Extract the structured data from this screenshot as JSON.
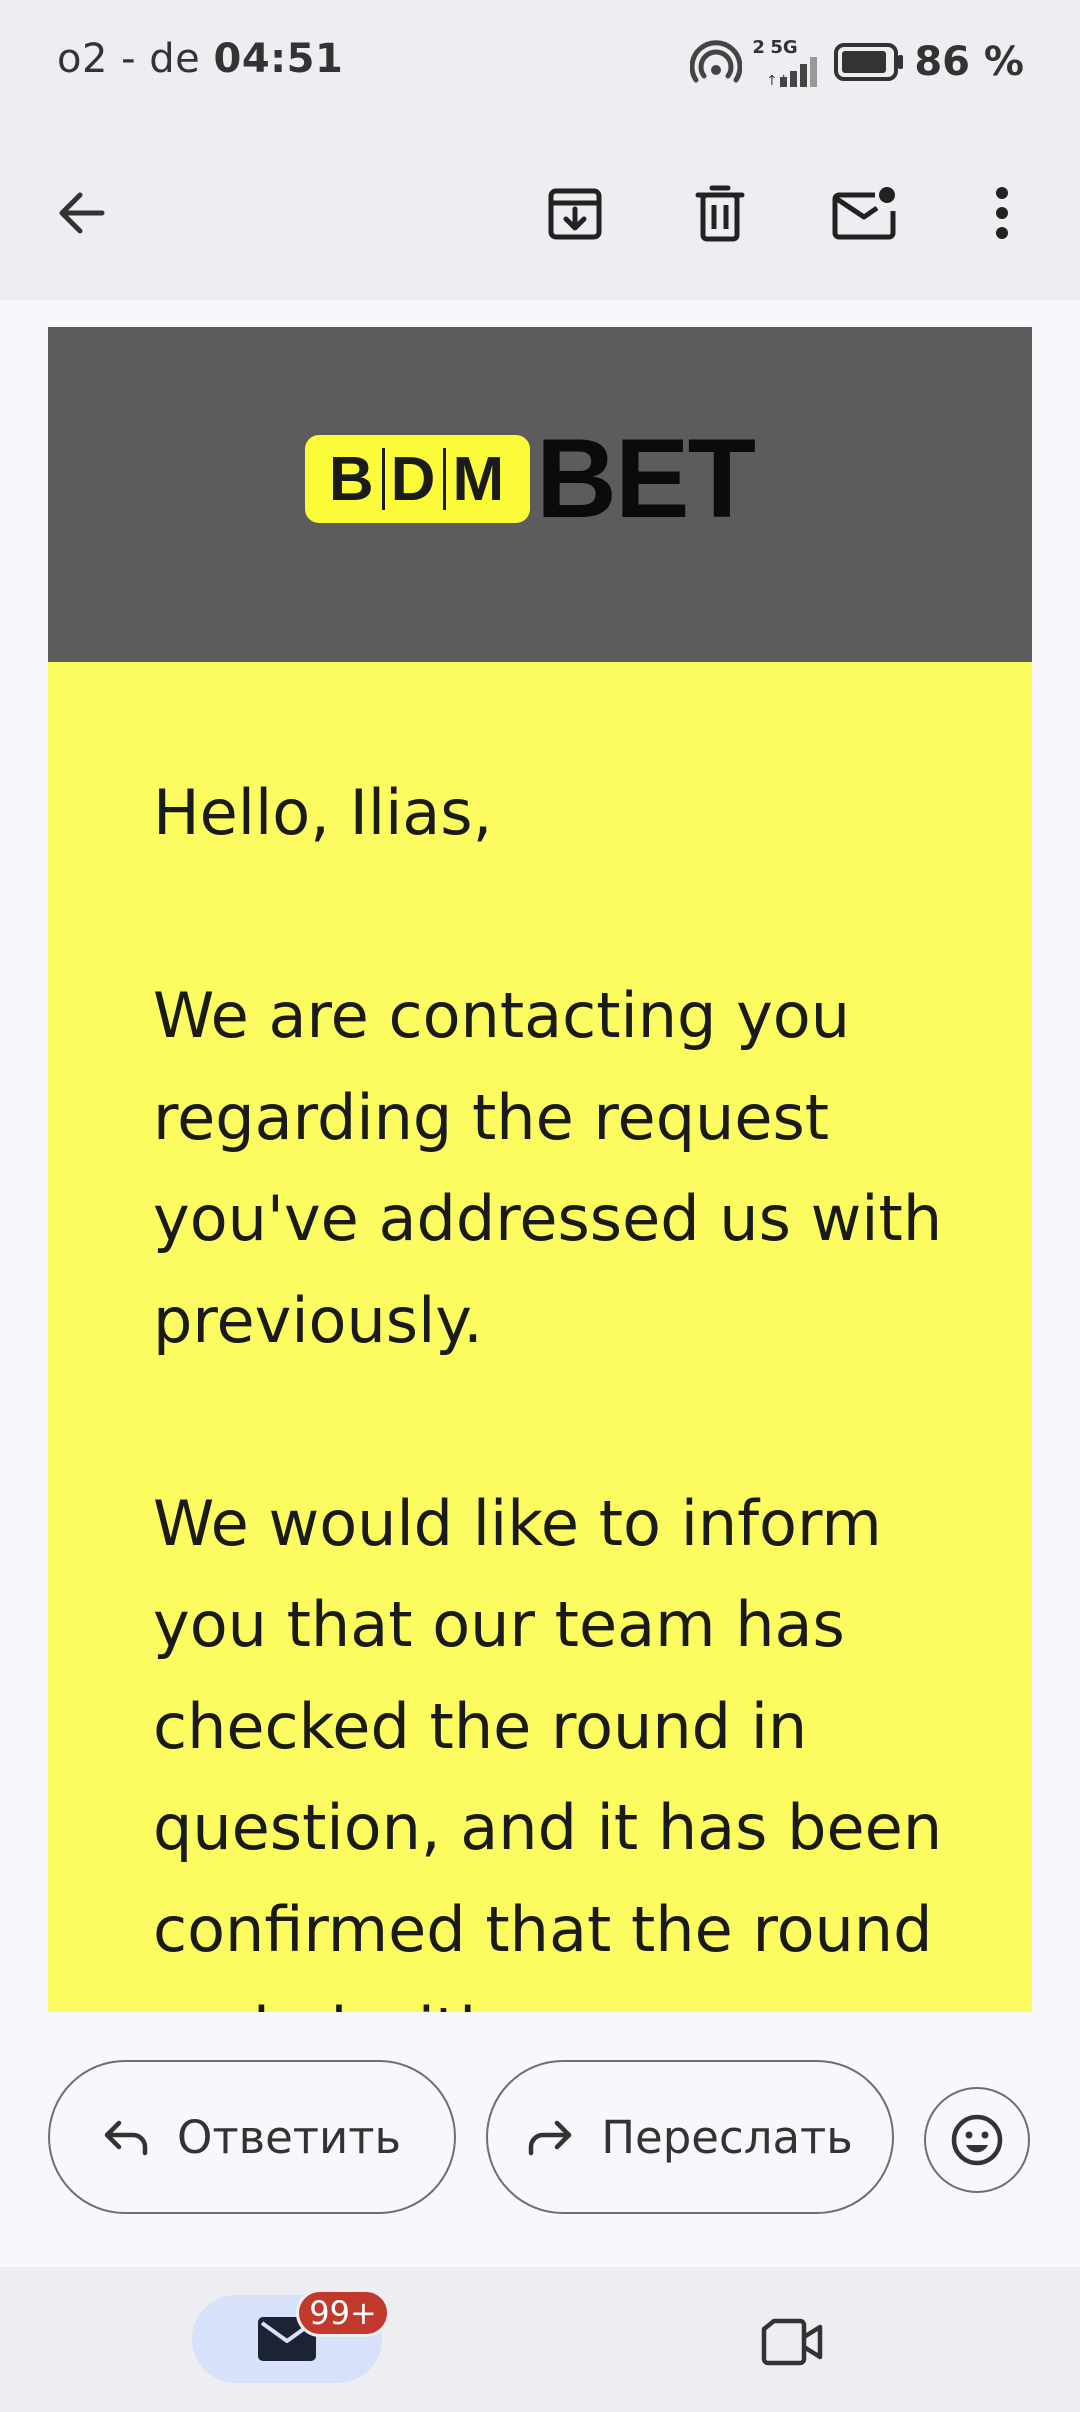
{
  "status_bar": {
    "carrier": "o2 - de",
    "time": "04:51",
    "sim_indicator": "2",
    "network": "5G",
    "battery": "86 %"
  },
  "app_bar": {
    "icons": [
      "back-arrow-icon",
      "archive-icon",
      "delete-icon",
      "mark-unread-icon",
      "more-vert-icon"
    ]
  },
  "email": {
    "logo": {
      "letters": [
        "B",
        "D",
        "M"
      ],
      "word": "BET"
    },
    "paragraphs": [
      "Hello, Ilias,",
      "We are contacting you regarding the request you've addressed us with previously.",
      "We would like to inform you that our team has checked the round in question, and it has been confirmed that the round ended with"
    ],
    "colors": {
      "header_bg": "#5c5c5c",
      "body_bg": "#fcfc60",
      "logo_yellow": "#fcfc3a"
    }
  },
  "actions": {
    "reply_label": "Ответить",
    "forward_label": "Переслать"
  },
  "bottom_nav": {
    "mail_badge": "99+"
  }
}
